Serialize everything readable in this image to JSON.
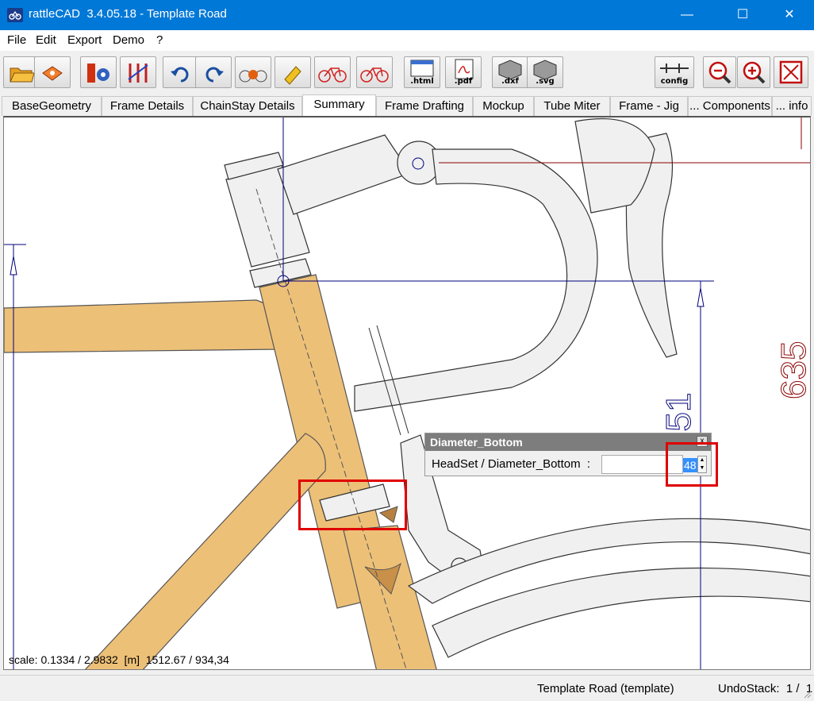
{
  "window": {
    "title": "rattleCAD  3.4.05.18 - Template Road",
    "minimize_glyph": "—",
    "maximize_glyph": "☐",
    "close_glyph": "✕"
  },
  "menu": [
    "File",
    "Edit",
    "Export",
    "Demo",
    "?"
  ],
  "toolbar": {
    "buttons": [
      {
        "icon": "open-folder-icon"
      },
      {
        "icon": "save-disk-icon"
      },
      {
        "icon": "frame-settings-icon"
      },
      {
        "icon": "geometry-compare-icon"
      },
      {
        "icon": "undo-icon"
      },
      {
        "icon": "redo-icon"
      },
      {
        "icon": "bike-render-icon"
      },
      {
        "icon": "paint-icon"
      },
      {
        "icon": "bike-red-icon"
      },
      {
        "icon": "bike-red-alt-icon"
      },
      {
        "icon": "export-html-icon",
        "label": ".html"
      },
      {
        "icon": "export-pdf-icon",
        "label": ".pdf"
      },
      {
        "icon": "export-dxf-icon",
        "label": ".dxf"
      },
      {
        "icon": "export-svg-icon",
        "label": ".svg"
      },
      {
        "icon": "config-icon",
        "label": "config"
      },
      {
        "icon": "zoom-out-icon"
      },
      {
        "icon": "zoom-in-icon"
      },
      {
        "icon": "fit-view-icon"
      }
    ]
  },
  "tabs": [
    "BaseGeometry",
    "Frame Details",
    "ChainStay Details",
    "Summary",
    "Frame Drafting",
    "Mockup",
    "Tube Miter",
    "Frame - Jig",
    "... Components",
    "... info"
  ],
  "active_tab": "Summary",
  "canvas": {
    "scale_text": "scale: 0.1334 / 2.9832  [m]  1512.67 / 934,34",
    "dimension_labels": [
      "635",
      "151"
    ],
    "colors": {
      "tube_fill": "#edc078",
      "dimension_line": "#00007a",
      "centerline_red": "#8b0000",
      "highlight": "#e00000"
    }
  },
  "edit_popup": {
    "title": "Diameter_Bottom",
    "close_glyph": "x",
    "label": "HeadSet / Diameter_Bottom  :",
    "value": "48",
    "spin_up": "▲",
    "spin_down": "▼"
  },
  "statusbar": {
    "document": "Template Road (template)",
    "undo": "UndoStack:  1 /  1"
  }
}
